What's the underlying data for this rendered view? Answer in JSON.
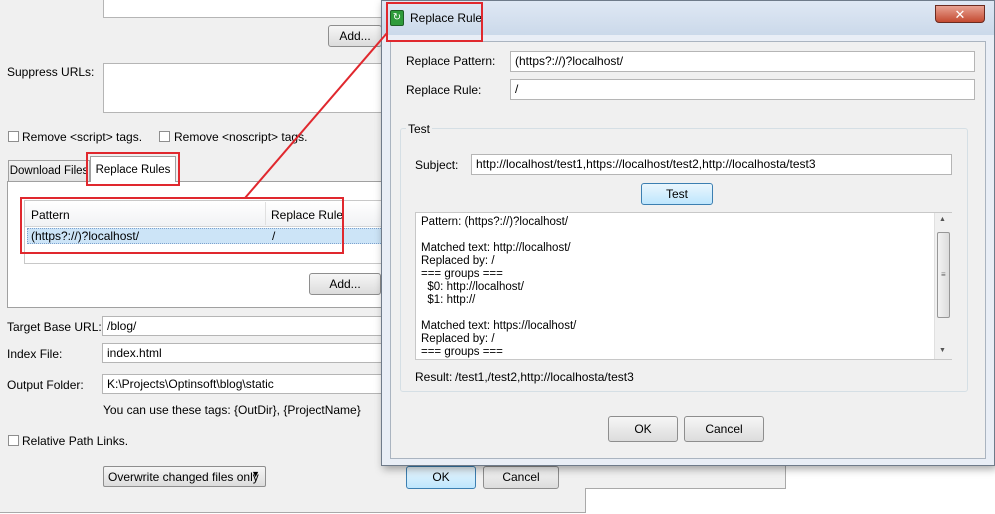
{
  "main": {
    "add_button_top": "Add...",
    "suppress_urls_label": "Suppress URLs:",
    "remove_script_label": "Remove <script> tags.",
    "remove_noscript_label": "Remove <noscript> tags.",
    "tabs": [
      {
        "label": "Download Files"
      },
      {
        "label": "Replace Rules"
      }
    ],
    "table": {
      "columns": [
        "Pattern",
        "Replace Rule"
      ],
      "rows": [
        {
          "pattern": "(https?://)?localhost/",
          "rule": "/"
        }
      ]
    },
    "add_button": "Add...",
    "target_base_url_label": "Target Base URL:",
    "target_base_url_value": "/blog/",
    "index_file_label": "Index File:",
    "index_file_value": "index.html",
    "output_folder_label": "Output Folder:",
    "output_folder_value": "K:\\Projects\\Optinsoft\\blog\\static",
    "tags_hint": "You can use these tags: {OutDir}, {ProjectName}",
    "relative_path_label": "Relative Path Links.",
    "overwrite_select": "Overwrite changed files only",
    "ok_button": "OK",
    "cancel_button": "Cancel"
  },
  "dialog": {
    "title": "Replace Rule",
    "close_glyph": "✕",
    "replace_pattern_label": "Replace Pattern:",
    "replace_pattern_value": "(https?://)?localhost/",
    "replace_rule_label": "Replace Rule:",
    "replace_rule_value": "/",
    "test_group_label": "Test",
    "subject_label": "Subject:",
    "subject_value": "http://localhost/test1,https://localhost/test2,http://localhosta/test3",
    "test_button": "Test",
    "output_lines": [
      "Pattern: (https?://)?localhost/",
      "",
      "Matched text: http://localhost/",
      "Replaced by: /",
      "=== groups ===",
      "  $0: http://localhost/",
      "  $1: http://",
      "",
      "Matched text: https://localhost/",
      "Replaced by: /",
      "=== groups ==="
    ],
    "result_label": "Result:",
    "result_value": "/test1,/test2,http://localhosta/test3",
    "ok_button": "OK",
    "cancel_button": "Cancel"
  },
  "colors": {
    "annotation": "#e0282e",
    "selection": "#cce4f7"
  }
}
